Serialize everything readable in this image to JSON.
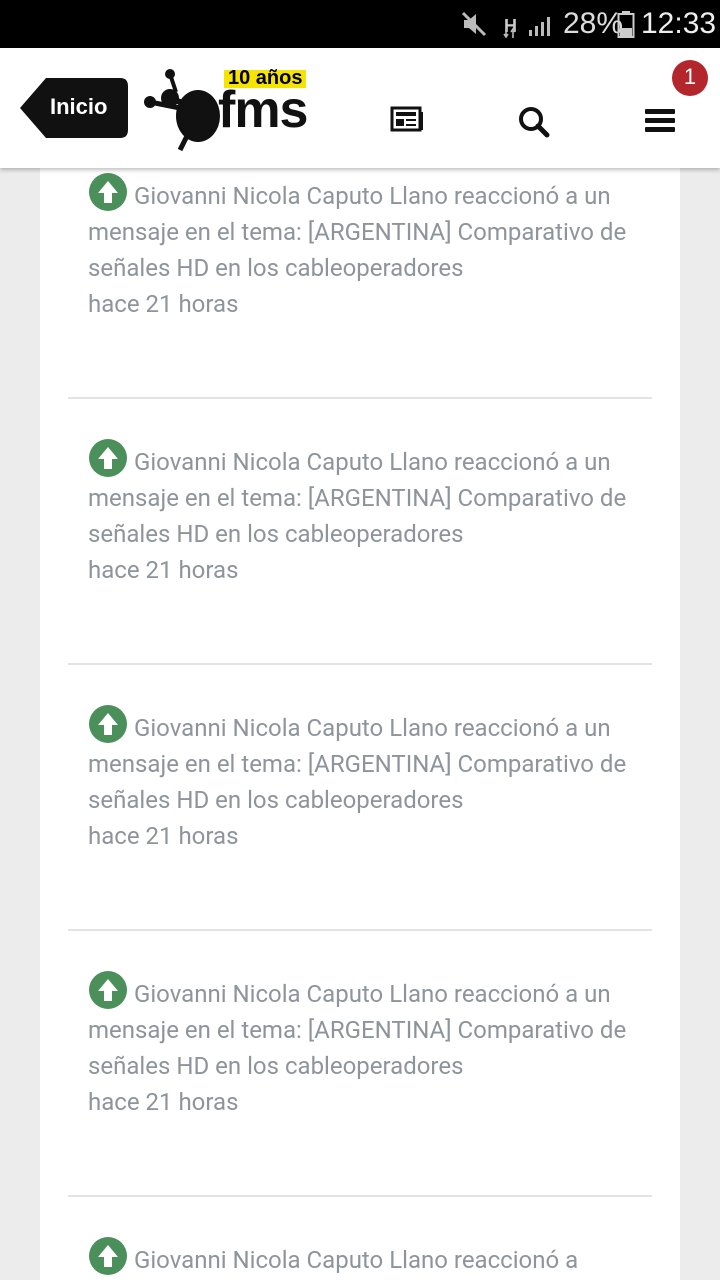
{
  "status_bar": {
    "battery": "28%",
    "time": "12:33",
    "network": "H"
  },
  "header": {
    "home_button": "Inicio",
    "logo": {
      "brand": "fms",
      "anniversary": "10 años"
    },
    "notification_count": "1"
  },
  "colors": {
    "accent_green": "#4b8f5b",
    "badge_red": "#b3262b",
    "text_grey": "#8d949b"
  },
  "feed": [
    {
      "actor": "Giovanni Nicola Caputo Llano",
      "action": " reaccionó a un mensaje en el tema: ",
      "topic": "[ARGENTINA] Comparativo de señales HD en los cableoperadores",
      "time": "hace 21 horas"
    },
    {
      "actor": "Giovanni Nicola Caputo Llano",
      "action": " reaccionó a un mensaje en el tema: ",
      "topic": "[ARGENTINA] Comparativo de señales HD en los cableoperadores",
      "time": "hace 21 horas"
    },
    {
      "actor": "Giovanni Nicola Caputo Llano",
      "action": " reaccionó a un mensaje en el tema: ",
      "topic": "[ARGENTINA] Comparativo de señales HD en los cableoperadores",
      "time": "hace 21 horas"
    },
    {
      "actor": "Giovanni Nicola Caputo Llano",
      "action": " reaccionó a un mensaje en el tema: ",
      "topic": "[ARGENTINA] Comparativo de señales HD en los cableoperadores",
      "time": "hace 21 horas"
    },
    {
      "actor": "Giovanni Nicola Caputo Llano",
      "action": " reaccionó a",
      "topic": "",
      "time": ""
    }
  ]
}
